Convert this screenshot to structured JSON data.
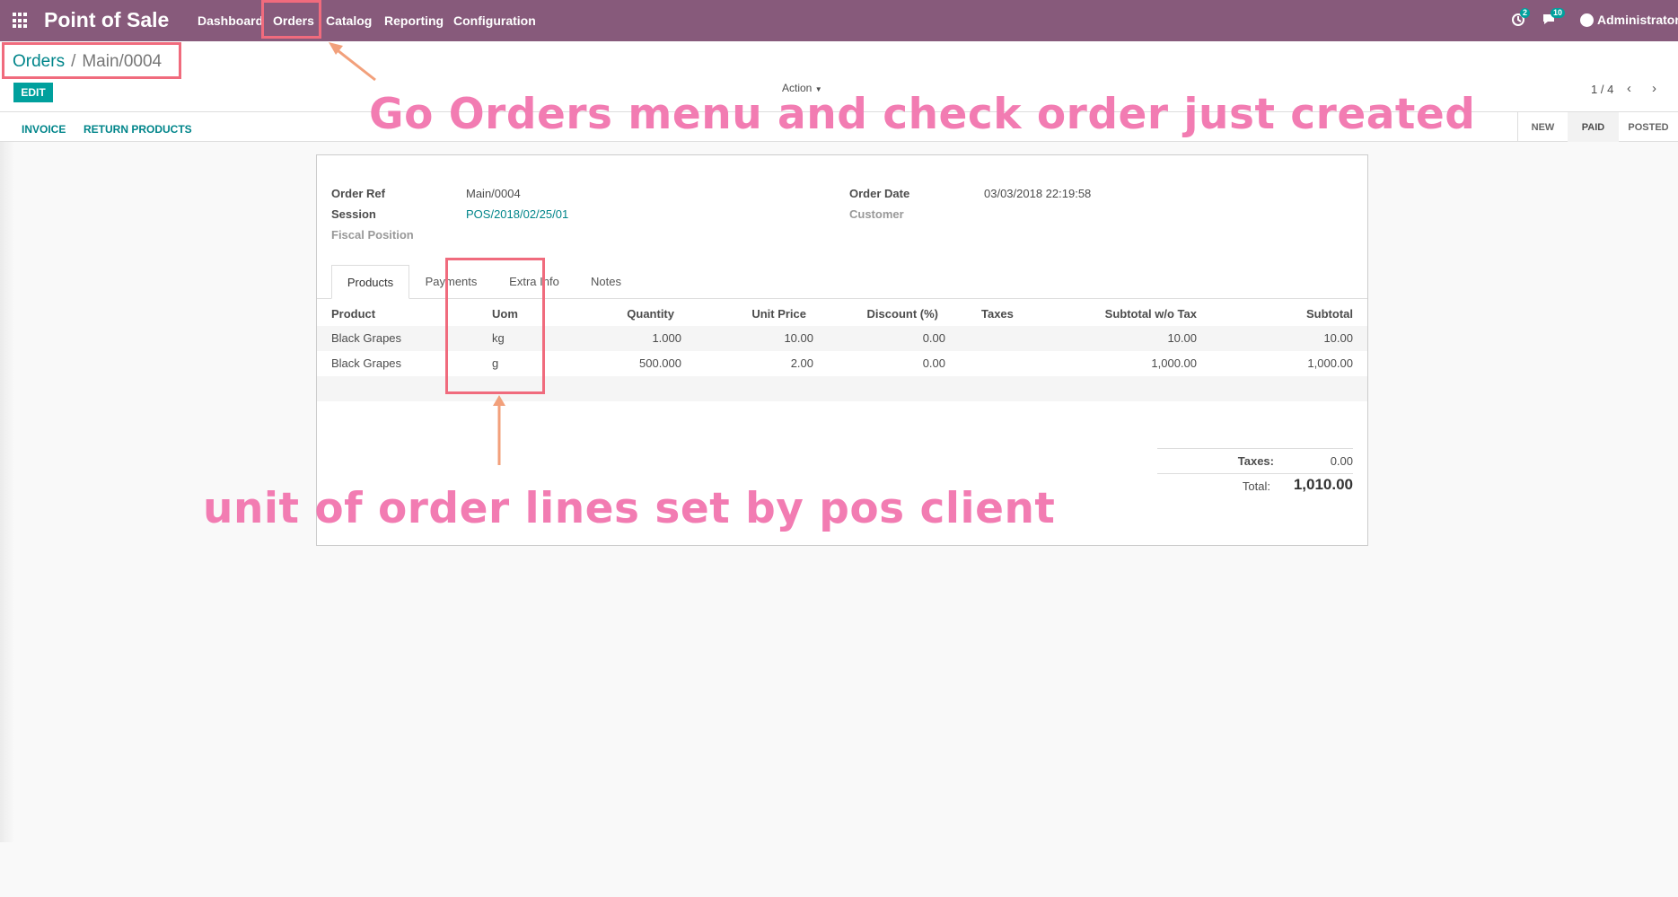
{
  "navbar": {
    "brand": "Point of Sale",
    "menu": [
      "Dashboard",
      "Orders",
      "Catalog",
      "Reporting",
      "Configuration"
    ],
    "activity_count": "2",
    "messages_count": "10",
    "user": "Administrator"
  },
  "breadcrumb": {
    "parent": "Orders",
    "separator": "/",
    "current": "Main/0004"
  },
  "control": {
    "edit_label": "EDIT",
    "action_label": "Action",
    "pager": "1 / 4"
  },
  "statusbar": {
    "buttons": [
      "INVOICE",
      "RETURN PRODUCTS"
    ],
    "stages": [
      "NEW",
      "PAID",
      "POSTED"
    ],
    "active_stage": "PAID"
  },
  "form": {
    "order_ref_label": "Order Ref",
    "order_ref": "Main/0004",
    "session_label": "Session",
    "session": "POS/2018/02/25/01",
    "fiscal_position_label": "Fiscal Position",
    "order_date_label": "Order Date",
    "order_date": "03/03/2018 22:19:58",
    "customer_label": "Customer"
  },
  "tabs": [
    "Products",
    "Payments",
    "Extra Info",
    "Notes"
  ],
  "lines": {
    "headers": [
      "Product",
      "Uom",
      "Quantity",
      "Unit Price",
      "Discount (%)",
      "Taxes",
      "Subtotal w/o Tax",
      "Subtotal"
    ],
    "rows": [
      {
        "product": "Black Grapes",
        "uom": "kg",
        "qty": "1.000",
        "price": "10.00",
        "discount": "0.00",
        "taxes": "",
        "subtotal_wo": "10.00",
        "subtotal": "10.00"
      },
      {
        "product": "Black Grapes",
        "uom": "g",
        "qty": "500.000",
        "price": "2.00",
        "discount": "0.00",
        "taxes": "",
        "subtotal_wo": "1,000.00",
        "subtotal": "1,000.00"
      }
    ]
  },
  "totals": {
    "taxes_label": "Taxes:",
    "taxes": "0.00",
    "total_label": "Total:",
    "total": "1,010.00"
  },
  "annotations": {
    "top": "Go Orders menu and check order just created",
    "bottom": "unit of order lines set by pos client",
    "color": "#f27cb2"
  }
}
